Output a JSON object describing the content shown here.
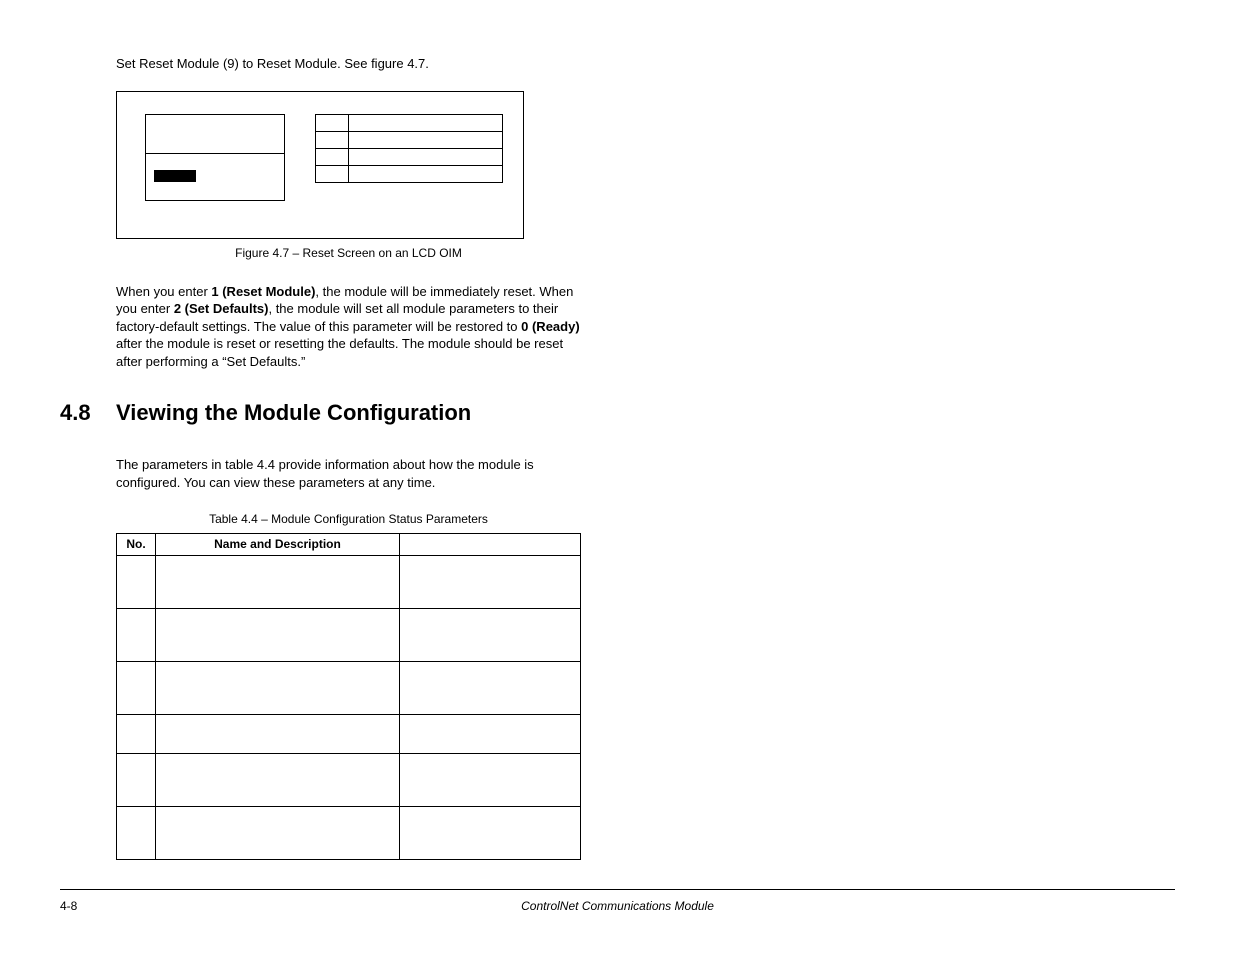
{
  "top_line": "Set Reset Module (9) to Reset Module. See figure 4.7.",
  "figure_caption": "Figure 4.7 – Reset Screen on an LCD OIM",
  "para1_a": "When you enter ",
  "para1_b": "1 (Reset Module)",
  "para1_c": ", the module will be immediately reset. When you enter ",
  "para1_d": "2 (Set Defaults)",
  "para1_e": ", the module will set all module parameters to their factory-default settings. The value of this parameter will be restored to ",
  "para1_f": "0 (Ready)",
  "para1_g": " after the module is reset or resetting the defaults. The module should be reset after performing a “Set Defaults.”",
  "section_number": "4.8",
  "section_title": "Viewing the Module Configuration",
  "section_intro": "The parameters in table 4.4 provide information about how the module is configured. You can view these parameters at any time.",
  "table_caption": "Table 4.4 – Module Configuration Status Parameters",
  "table_headers": {
    "no": "No.",
    "name": "Name and Description",
    "details": ""
  },
  "table_rows": [
    {
      "no": "",
      "name": "",
      "details": "",
      "short": false
    },
    {
      "no": "",
      "name": "",
      "details": "",
      "short": false
    },
    {
      "no": "",
      "name": "",
      "details": "",
      "short": false
    },
    {
      "no": "",
      "name": "",
      "details": "",
      "short": true
    },
    {
      "no": "",
      "name": "",
      "details": "",
      "short": false
    },
    {
      "no": "",
      "name": "",
      "details": "",
      "short": false
    }
  ],
  "footer": {
    "page": "4-8",
    "doc_title": "ControlNet Communications Module"
  }
}
